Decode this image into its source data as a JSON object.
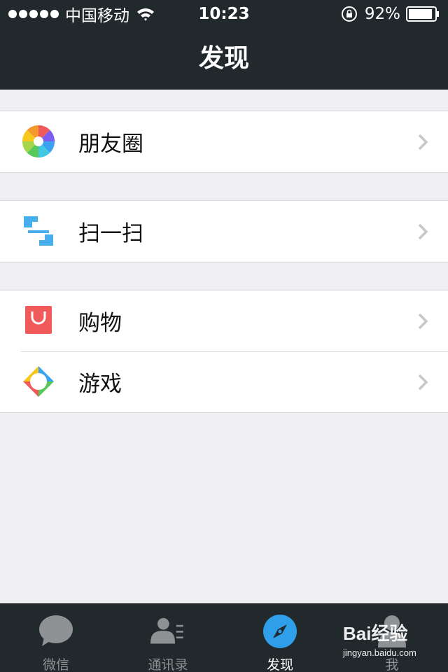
{
  "status_bar": {
    "carrier": "中国移动",
    "time": "10:23",
    "battery": "92%",
    "battery_level": 0.92,
    "icons": [
      "signal-dots",
      "wifi-icon",
      "rotation-lock-icon",
      "battery-icon"
    ]
  },
  "nav": {
    "title": "发现"
  },
  "groups": [
    {
      "items": [
        {
          "label": "朋友圈",
          "icon": "moments-icon"
        }
      ]
    },
    {
      "items": [
        {
          "label": "扫一扫",
          "icon": "scan-icon"
        }
      ]
    },
    {
      "items": [
        {
          "label": "购物",
          "icon": "shopping-bag-icon"
        },
        {
          "label": "游戏",
          "icon": "game-icon"
        }
      ]
    }
  ],
  "tabs": [
    {
      "label": "微信",
      "icon": "chat-bubble-icon",
      "active": false
    },
    {
      "label": "通讯录",
      "icon": "contacts-icon",
      "active": false
    },
    {
      "label": "发现",
      "icon": "compass-icon",
      "active": true
    },
    {
      "label": "我",
      "icon": "person-icon",
      "active": false
    }
  ],
  "watermark": {
    "brand": "Bai经验",
    "url": "jingyan.baidu.com"
  },
  "colors": {
    "bar_background": "#22292c",
    "page_background": "#efeff4",
    "active_tab": "#2f9fea",
    "inactive_tab": "#8f9294",
    "shopping": "#f05a5a"
  }
}
